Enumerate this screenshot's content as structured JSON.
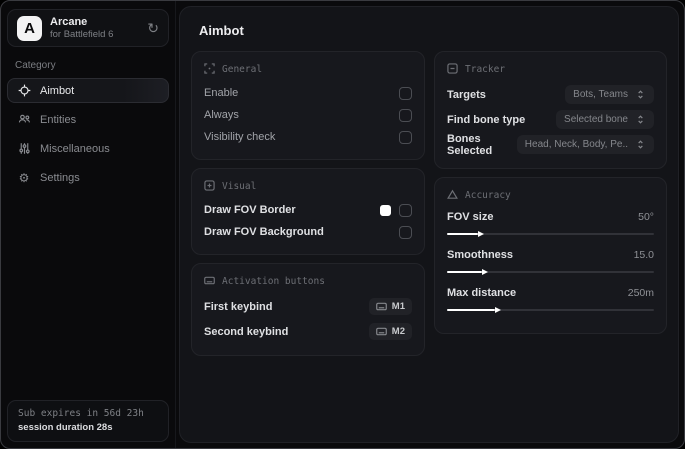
{
  "colors": {
    "window_background": "#0a0a0c",
    "panel_background": "#131418",
    "card_background": "#17181d",
    "fov_border_swatch": "#ffffff",
    "slider_fill": "#ffffff"
  },
  "icons": [
    "refresh-icon",
    "crosshair-icon",
    "entities-icon",
    "sliders-icon",
    "gear-icon",
    "focus-icon",
    "image-plus-icon",
    "keyboard-icon",
    "box-minus-icon",
    "triangle-icon",
    "expand-icon"
  ],
  "app": {
    "logo_letter": "A",
    "name": "Arcane",
    "subtitle": "for Battlefield 6"
  },
  "sidebar": {
    "category_label": "Category",
    "items": [
      {
        "label": "Aimbot",
        "icon": "crosshair-icon",
        "active": true
      },
      {
        "label": "Entities",
        "icon": "entities-icon",
        "active": false
      },
      {
        "label": "Miscellaneous",
        "icon": "sliders-icon",
        "active": false
      },
      {
        "label": "Settings",
        "icon": "gear-icon",
        "active": false
      }
    ],
    "subscription": {
      "expires": "Sub expires in 56d 23h",
      "session": "session duration 28s"
    }
  },
  "main": {
    "title": "Aimbot",
    "cards": {
      "general": {
        "title": "General",
        "rows": [
          {
            "label": "Enable",
            "control": "checkbox",
            "checked": false
          },
          {
            "label": "Always",
            "control": "checkbox",
            "checked": false
          },
          {
            "label": "Visibility check",
            "control": "checkbox",
            "checked": false
          }
        ]
      },
      "visual": {
        "title": "Visual",
        "rows": [
          {
            "label": "Draw FOV Border",
            "control": "color+checkbox",
            "color": "#ffffff",
            "checked": false
          },
          {
            "label": "Draw FOV Background",
            "control": "checkbox",
            "checked": false
          }
        ]
      },
      "activation": {
        "title": "Activation buttons",
        "rows": [
          {
            "label": "First keybind",
            "key": "M1"
          },
          {
            "label": "Second keybind",
            "key": "M2"
          }
        ]
      },
      "tracker": {
        "title": "Tracker",
        "rows": [
          {
            "label": "Targets",
            "value": "Bots, Teams"
          },
          {
            "label": "Find bone type",
            "value": "Selected bone"
          },
          {
            "label": "Bones Selected",
            "value": "Head, Neck, Body, Pe.."
          }
        ]
      },
      "accuracy": {
        "title": "Accuracy",
        "sliders": [
          {
            "label": "FOV size",
            "value": "50°",
            "percent": 15
          },
          {
            "label": "Smoothness",
            "value": "15.0",
            "percent": 17
          },
          {
            "label": "Max distance",
            "value": "250m",
            "percent": 23
          }
        ]
      }
    }
  }
}
